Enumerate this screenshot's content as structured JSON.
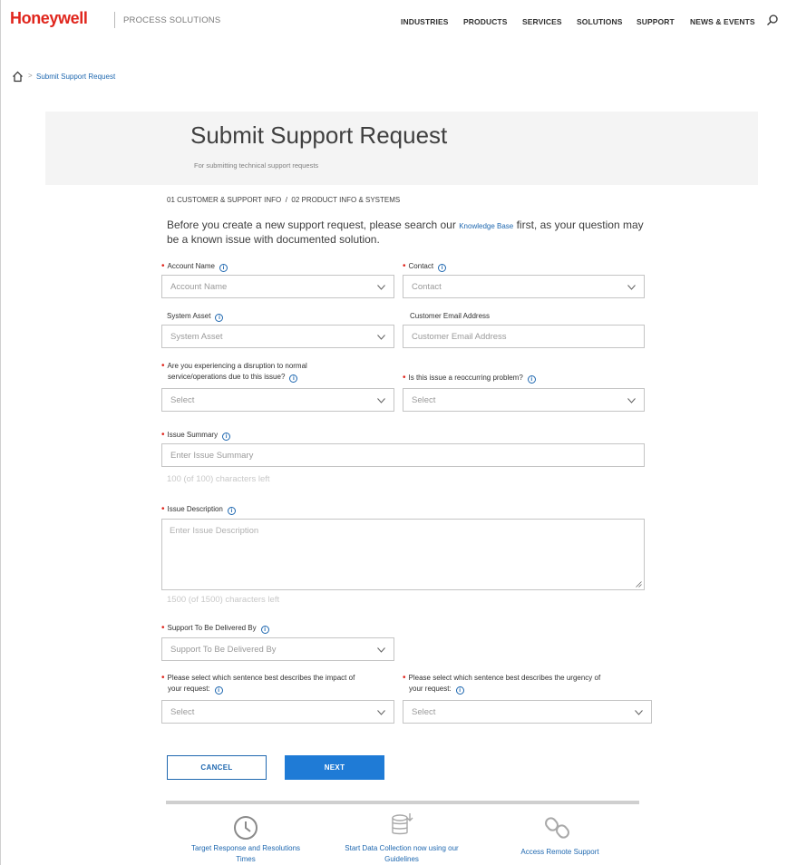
{
  "header": {
    "logo": "Honeywell",
    "subtitle": "PROCESS SOLUTIONS",
    "nav": [
      "INDUSTRIES",
      "PRODUCTS",
      "SERVICES",
      "SOLUTIONS",
      "SUPPORT",
      "NEWS & EVENTS"
    ],
    "search_icon": "search-icon"
  },
  "breadcrumb": {
    "home_icon": "home-icon",
    "separator": ">",
    "current": "Submit Support Request"
  },
  "banner": {
    "title": "Submit Support Request",
    "subtitle": "For submitting technical support requests"
  },
  "steps": "01 CUSTOMER & SUPPORT INFO  /  02 PRODUCT INFO & SYSTEMS",
  "intro": {
    "before": "Before you create a new support request, please search our ",
    "link": "Knowledge Base",
    "after": " first, as your question may be a known issue with documented solution."
  },
  "form": {
    "required_mark": "•",
    "info_glyph": "i",
    "account_name": {
      "label": "Account Name",
      "placeholder": "Account Name"
    },
    "contact": {
      "label": "Contact",
      "placeholder": "Contact"
    },
    "system_asset": {
      "label": "System Asset",
      "placeholder": "System Asset"
    },
    "customer_email": {
      "label": "Customer Email Address",
      "placeholder": "Customer Email Address"
    },
    "disruption": {
      "label_line1": "Are you experiencing a disruption to normal",
      "label_line2": "service/operations due to this issue?",
      "placeholder": "Select"
    },
    "reoccurring": {
      "label": "Is this issue a reoccurring problem?",
      "placeholder": "Select"
    },
    "issue_summary": {
      "label": "Issue Summary",
      "placeholder": "Enter Issue Summary",
      "counter": "100 (of 100) characters left"
    },
    "issue_description": {
      "label": "Issue Description",
      "placeholder": "Enter Issue Description",
      "counter": "1500 (of 1500) characters left"
    },
    "delivered_by": {
      "label": "Support To Be Delivered By",
      "placeholder": "Support To Be Delivered By"
    },
    "impact": {
      "label_line1": "Please select which sentence best describes the impact of",
      "label_line2": "your request:",
      "placeholder": "Select"
    },
    "urgency": {
      "label_line1": "Please select which sentence best describes the urgency of",
      "label_line2": "your request:",
      "placeholder": "Select"
    }
  },
  "buttons": {
    "cancel": "CANCEL",
    "next": "NEXT"
  },
  "footer_links": [
    {
      "icon": "clock-icon",
      "line1": "Target Response and Resolutions",
      "line2": "Times"
    },
    {
      "icon": "database-icon",
      "line1": "Start Data Collection now using our",
      "line2": "Guidelines"
    },
    {
      "icon": "chain-link-icon",
      "line1": "Access Remote Support",
      "line2": ""
    }
  ],
  "colors": {
    "brand_red": "#e0261d",
    "link_blue": "#1f68b0",
    "button_blue": "#1f7bd6"
  }
}
